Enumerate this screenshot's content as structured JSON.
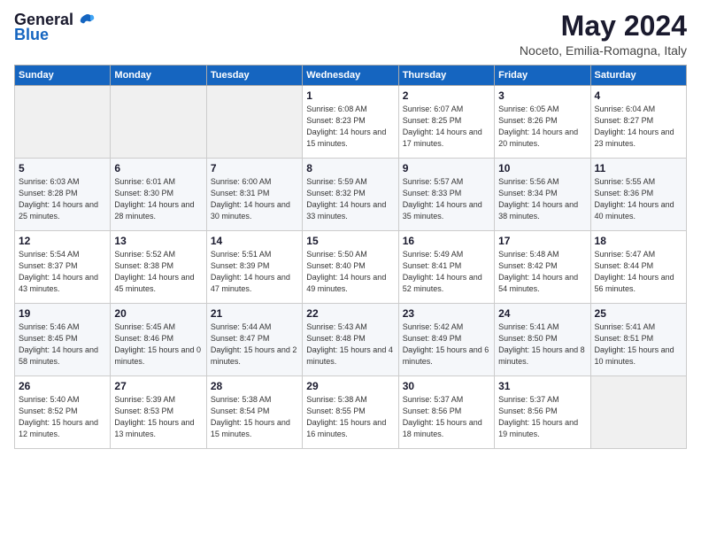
{
  "header": {
    "logo_general": "General",
    "logo_blue": "Blue",
    "title": "May 2024",
    "subtitle": "Noceto, Emilia-Romagna, Italy"
  },
  "days_of_week": [
    "Sunday",
    "Monday",
    "Tuesday",
    "Wednesday",
    "Thursday",
    "Friday",
    "Saturday"
  ],
  "weeks": [
    [
      {
        "day": "",
        "info": ""
      },
      {
        "day": "",
        "info": ""
      },
      {
        "day": "",
        "info": ""
      },
      {
        "day": "1",
        "info": "Sunrise: 6:08 AM\nSunset: 8:23 PM\nDaylight: 14 hours\nand 15 minutes."
      },
      {
        "day": "2",
        "info": "Sunrise: 6:07 AM\nSunset: 8:25 PM\nDaylight: 14 hours\nand 17 minutes."
      },
      {
        "day": "3",
        "info": "Sunrise: 6:05 AM\nSunset: 8:26 PM\nDaylight: 14 hours\nand 20 minutes."
      },
      {
        "day": "4",
        "info": "Sunrise: 6:04 AM\nSunset: 8:27 PM\nDaylight: 14 hours\nand 23 minutes."
      }
    ],
    [
      {
        "day": "5",
        "info": "Sunrise: 6:03 AM\nSunset: 8:28 PM\nDaylight: 14 hours\nand 25 minutes."
      },
      {
        "day": "6",
        "info": "Sunrise: 6:01 AM\nSunset: 8:30 PM\nDaylight: 14 hours\nand 28 minutes."
      },
      {
        "day": "7",
        "info": "Sunrise: 6:00 AM\nSunset: 8:31 PM\nDaylight: 14 hours\nand 30 minutes."
      },
      {
        "day": "8",
        "info": "Sunrise: 5:59 AM\nSunset: 8:32 PM\nDaylight: 14 hours\nand 33 minutes."
      },
      {
        "day": "9",
        "info": "Sunrise: 5:57 AM\nSunset: 8:33 PM\nDaylight: 14 hours\nand 35 minutes."
      },
      {
        "day": "10",
        "info": "Sunrise: 5:56 AM\nSunset: 8:34 PM\nDaylight: 14 hours\nand 38 minutes."
      },
      {
        "day": "11",
        "info": "Sunrise: 5:55 AM\nSunset: 8:36 PM\nDaylight: 14 hours\nand 40 minutes."
      }
    ],
    [
      {
        "day": "12",
        "info": "Sunrise: 5:54 AM\nSunset: 8:37 PM\nDaylight: 14 hours\nand 43 minutes."
      },
      {
        "day": "13",
        "info": "Sunrise: 5:52 AM\nSunset: 8:38 PM\nDaylight: 14 hours\nand 45 minutes."
      },
      {
        "day": "14",
        "info": "Sunrise: 5:51 AM\nSunset: 8:39 PM\nDaylight: 14 hours\nand 47 minutes."
      },
      {
        "day": "15",
        "info": "Sunrise: 5:50 AM\nSunset: 8:40 PM\nDaylight: 14 hours\nand 49 minutes."
      },
      {
        "day": "16",
        "info": "Sunrise: 5:49 AM\nSunset: 8:41 PM\nDaylight: 14 hours\nand 52 minutes."
      },
      {
        "day": "17",
        "info": "Sunrise: 5:48 AM\nSunset: 8:42 PM\nDaylight: 14 hours\nand 54 minutes."
      },
      {
        "day": "18",
        "info": "Sunrise: 5:47 AM\nSunset: 8:44 PM\nDaylight: 14 hours\nand 56 minutes."
      }
    ],
    [
      {
        "day": "19",
        "info": "Sunrise: 5:46 AM\nSunset: 8:45 PM\nDaylight: 14 hours\nand 58 minutes."
      },
      {
        "day": "20",
        "info": "Sunrise: 5:45 AM\nSunset: 8:46 PM\nDaylight: 15 hours\nand 0 minutes."
      },
      {
        "day": "21",
        "info": "Sunrise: 5:44 AM\nSunset: 8:47 PM\nDaylight: 15 hours\nand 2 minutes."
      },
      {
        "day": "22",
        "info": "Sunrise: 5:43 AM\nSunset: 8:48 PM\nDaylight: 15 hours\nand 4 minutes."
      },
      {
        "day": "23",
        "info": "Sunrise: 5:42 AM\nSunset: 8:49 PM\nDaylight: 15 hours\nand 6 minutes."
      },
      {
        "day": "24",
        "info": "Sunrise: 5:41 AM\nSunset: 8:50 PM\nDaylight: 15 hours\nand 8 minutes."
      },
      {
        "day": "25",
        "info": "Sunrise: 5:41 AM\nSunset: 8:51 PM\nDaylight: 15 hours\nand 10 minutes."
      }
    ],
    [
      {
        "day": "26",
        "info": "Sunrise: 5:40 AM\nSunset: 8:52 PM\nDaylight: 15 hours\nand 12 minutes."
      },
      {
        "day": "27",
        "info": "Sunrise: 5:39 AM\nSunset: 8:53 PM\nDaylight: 15 hours\nand 13 minutes."
      },
      {
        "day": "28",
        "info": "Sunrise: 5:38 AM\nSunset: 8:54 PM\nDaylight: 15 hours\nand 15 minutes."
      },
      {
        "day": "29",
        "info": "Sunrise: 5:38 AM\nSunset: 8:55 PM\nDaylight: 15 hours\nand 16 minutes."
      },
      {
        "day": "30",
        "info": "Sunrise: 5:37 AM\nSunset: 8:56 PM\nDaylight: 15 hours\nand 18 minutes."
      },
      {
        "day": "31",
        "info": "Sunrise: 5:37 AM\nSunset: 8:56 PM\nDaylight: 15 hours\nand 19 minutes."
      },
      {
        "day": "",
        "info": ""
      }
    ]
  ]
}
